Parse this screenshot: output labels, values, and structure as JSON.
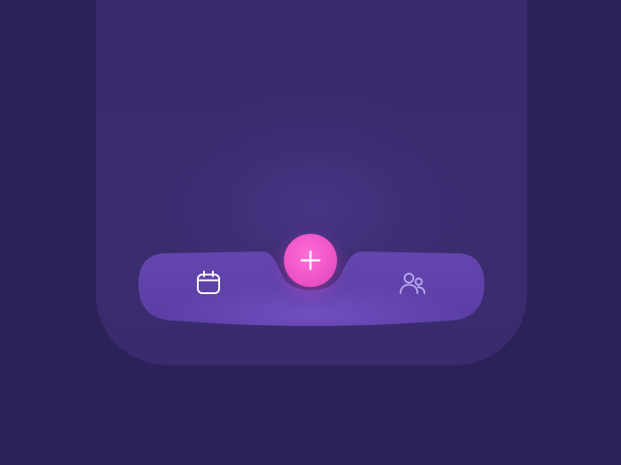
{
  "tabbar": {
    "items": [
      {
        "icon": "calendar-icon",
        "active": true
      },
      {
        "icon": "plus-icon",
        "action": "add"
      },
      {
        "icon": "people-icon",
        "active": false
      }
    ]
  },
  "colors": {
    "background": "#2d2159",
    "phone": "#3a2b6e",
    "tabbar": "#5b3fa6",
    "fab": "#f05ccb",
    "icon_active": "#ffffff",
    "icon_inactive": "#b9a6f0"
  }
}
